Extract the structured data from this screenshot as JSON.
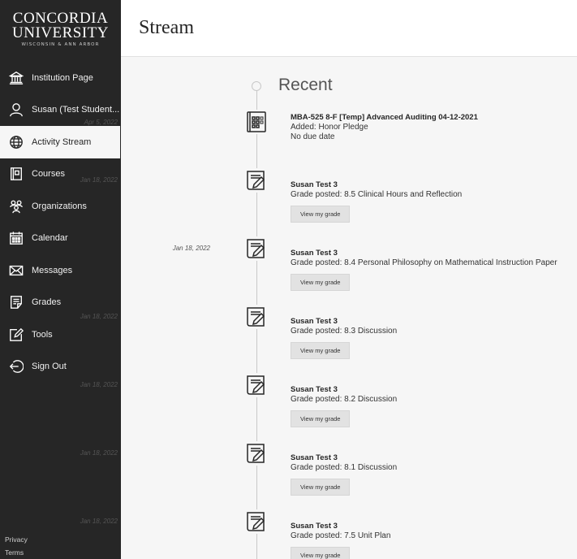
{
  "logo": {
    "line1": "CONCORDIA",
    "line2": "UNIVERSITY",
    "line3": "WISCONSIN & ANN ARBOR"
  },
  "header": {
    "title": "Stream"
  },
  "sidebar": {
    "items": [
      {
        "label": "Institution Page",
        "icon": "institution-icon"
      },
      {
        "label": "Susan (Test Student...",
        "icon": "user-icon"
      },
      {
        "label": "Activity Stream",
        "icon": "globe-icon",
        "active": true
      },
      {
        "label": "Courses",
        "icon": "courses-icon"
      },
      {
        "label": "Organizations",
        "icon": "organizations-icon"
      },
      {
        "label": "Calendar",
        "icon": "calendar-icon"
      },
      {
        "label": "Messages",
        "icon": "envelope-icon"
      },
      {
        "label": "Grades",
        "icon": "grades-icon"
      },
      {
        "label": "Tools",
        "icon": "tools-icon"
      },
      {
        "label": "Sign Out",
        "icon": "sign-out-icon"
      }
    ],
    "footer": {
      "privacy": "Privacy",
      "terms": "Terms"
    }
  },
  "stream": {
    "section_label": "Recent",
    "items": [
      {
        "date": "Apr 5, 2022",
        "icon": "calendar-grid-icon",
        "title": "MBA-525 8-F [Temp] Advanced Auditing 04-12-2021",
        "line1": "Added: Honor Pledge",
        "line2": "No due date"
      },
      {
        "date": "Jan 18, 2022",
        "icon": "grade-document-icon",
        "title": "Susan Test 3",
        "line1": "Grade posted: 8.5 Clinical Hours and Reflection",
        "button": "View my grade"
      },
      {
        "date": "Jan 18, 2022",
        "icon": "grade-document-icon",
        "title": "Susan Test 3",
        "line1": "Grade posted: 8.4 Personal Philosophy on Mathematical Instruction Paper",
        "button": "View my grade"
      },
      {
        "date": "Jan 18, 2022",
        "icon": "grade-document-icon",
        "title": "Susan Test 3",
        "line1": "Grade posted: 8.3 Discussion",
        "button": "View my grade"
      },
      {
        "date": "Jan 18, 2022",
        "icon": "grade-document-icon",
        "title": "Susan Test 3",
        "line1": "Grade posted: 8.2 Discussion",
        "button": "View my grade"
      },
      {
        "date": "Jan 18, 2022",
        "icon": "grade-document-icon",
        "title": "Susan Test 3",
        "line1": "Grade posted: 8.1 Discussion",
        "button": "View my grade"
      },
      {
        "date": "Jan 18, 2022",
        "icon": "grade-document-icon",
        "title": "Susan Test 3",
        "line1": "Grade posted: 7.5 Unit Plan",
        "button": "View my grade"
      }
    ]
  }
}
